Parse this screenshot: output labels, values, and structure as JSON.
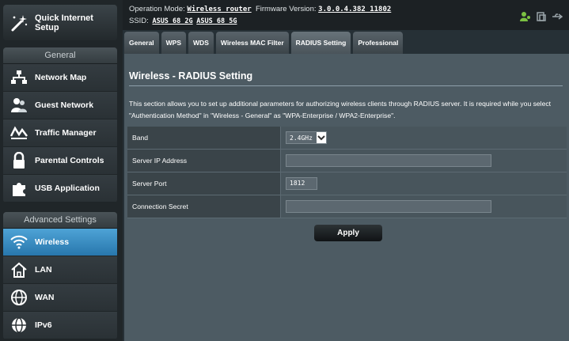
{
  "sidebar": {
    "quick_setup": "Quick Internet Setup",
    "general": {
      "title": "General",
      "items": [
        {
          "label": "Network Map",
          "icon": "network-map-icon"
        },
        {
          "label": "Guest Network",
          "icon": "guest-network-icon"
        },
        {
          "label": "Traffic Manager",
          "icon": "traffic-manager-icon"
        },
        {
          "label": "Parental Controls",
          "icon": "lock-icon"
        },
        {
          "label": "USB Application",
          "icon": "puzzle-icon"
        }
      ]
    },
    "advanced": {
      "title": "Advanced Settings",
      "items": [
        {
          "label": "Wireless",
          "icon": "wifi-icon",
          "active": true
        },
        {
          "label": "LAN",
          "icon": "home-icon"
        },
        {
          "label": "WAN",
          "icon": "globe-icon"
        },
        {
          "label": "IPv6",
          "icon": "ipv6-globe-icon"
        }
      ]
    }
  },
  "header": {
    "operation_mode_label": "Operation Mode:",
    "operation_mode_value": "Wireless router",
    "firmware_label": "Firmware Version:",
    "firmware_value": "3.0.0.4.382_11802",
    "ssid_label": "SSID:",
    "ssid_2g": "ASUS_68_2G",
    "ssid_5g": "ASUS_68_5G"
  },
  "tabs": [
    {
      "label": "General"
    },
    {
      "label": "WPS"
    },
    {
      "label": "WDS"
    },
    {
      "label": "Wireless MAC Filter"
    },
    {
      "label": "RADIUS Setting",
      "active": true
    },
    {
      "label": "Professional"
    }
  ],
  "page": {
    "title": "Wireless - RADIUS Setting",
    "description": "This section allows you to set up additional parameters for authorizing wireless clients through RADIUS server. It is required while you select \"Authentication Method\" in \"Wireless - General\" as \"WPA-Enterprise / WPA2-Enterprise\".",
    "fields": {
      "band_label": "Band",
      "band_value": "2.4GHz",
      "server_ip_label": "Server IP Address",
      "server_ip_value": "",
      "server_port_label": "Server Port",
      "server_port_value": "1812",
      "secret_label": "Connection Secret",
      "secret_value": ""
    },
    "apply_label": "Apply"
  },
  "colors": {
    "accent": "#3a8fc8",
    "status_green": "#7bc142"
  }
}
